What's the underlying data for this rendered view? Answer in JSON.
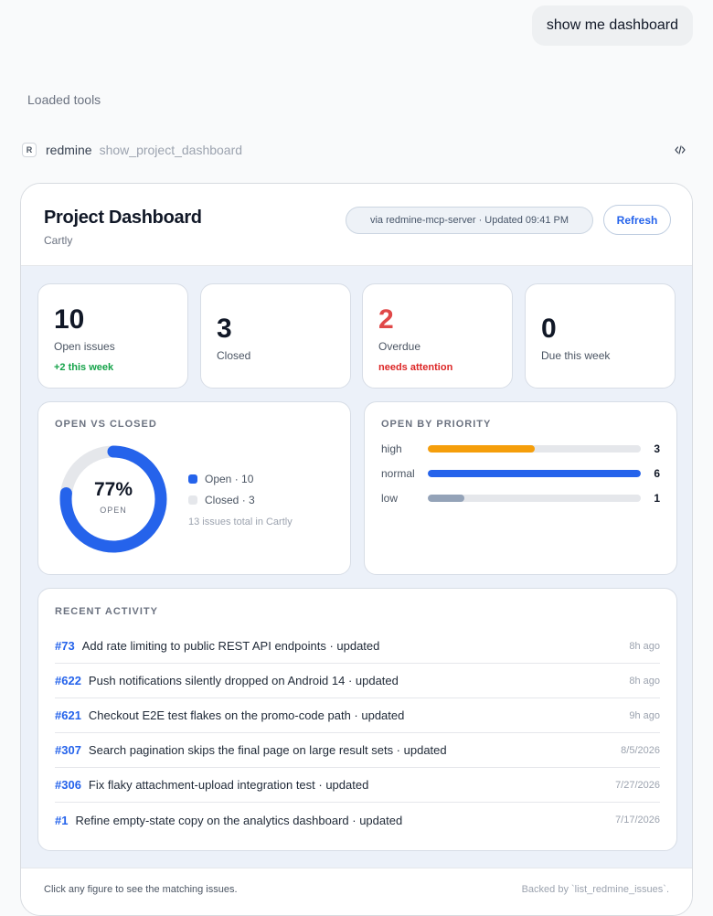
{
  "chat": {
    "user_message": "show me dashboard",
    "loaded_tools_label": "Loaded tools",
    "tool": {
      "badge": "R",
      "server": "redmine",
      "name": "show_project_dashboard",
      "code_icon": "code-icon"
    }
  },
  "dashboard": {
    "title": "Project Dashboard",
    "subtitle": "Cartly",
    "via": "via redmine-mcp-server · Updated 09:41 PM",
    "refresh_label": "Refresh",
    "stats": [
      {
        "value": "10",
        "label": "Open issues",
        "note": "+2 this week",
        "color": "#111827",
        "note_color": "#16a34a"
      },
      {
        "value": "3",
        "label": "Closed",
        "note": "",
        "color": "#111827"
      },
      {
        "value": "2",
        "label": "Overdue",
        "note": "needs attention",
        "color": "#e04848",
        "note_color": "#dc2626"
      },
      {
        "value": "0",
        "label": "Due this week",
        "note": "",
        "color": "#111827"
      }
    ],
    "open_vs_closed": {
      "title": "OPEN VS CLOSED",
      "percent_label": "77%",
      "center_caption": "OPEN",
      "open_legend": "Open · 10",
      "closed_legend": "Closed · 3",
      "total_text": "13 issues total in Cartly",
      "open_color": "#2563eb",
      "closed_color": "#e5e7eb"
    },
    "priority": {
      "title": "OPEN BY PRIORITY",
      "rows": [
        {
          "label": "high",
          "value": "3",
          "fill": 0.5,
          "color": "#f59e0b"
        },
        {
          "label": "normal",
          "value": "6",
          "fill": 1.0,
          "color": "#2563eb"
        },
        {
          "label": "low",
          "value": "1",
          "fill": 0.17,
          "color": "#94a3b8"
        }
      ]
    },
    "activity": {
      "title": "RECENT ACTIVITY",
      "items": [
        {
          "id": "#73",
          "text": "Add rate limiting to public REST API endpoints · updated",
          "time": "8h ago"
        },
        {
          "id": "#622",
          "text": "Push notifications silently dropped on Android 14 · updated",
          "time": "8h ago"
        },
        {
          "id": "#621",
          "text": "Checkout E2E test flakes on the promo-code path · updated",
          "time": "9h ago"
        },
        {
          "id": "#307",
          "text": "Search pagination skips the final page on large result sets · updated",
          "time": "8/5/2026"
        },
        {
          "id": "#306",
          "text": "Fix flaky attachment-upload integration test · updated",
          "time": "7/27/2026"
        },
        {
          "id": "#1",
          "text": "Refine empty-state copy on the analytics dashboard · updated",
          "time": "7/17/2026"
        }
      ]
    },
    "footer_left": "Click any figure to see the matching issues.",
    "footer_right": "Backed by `list_redmine_issues`."
  }
}
